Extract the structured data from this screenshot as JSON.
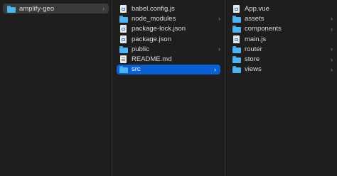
{
  "column1": {
    "items": [
      {
        "label": "amplify-geo",
        "icon": "folder-icon",
        "chevron": "›",
        "state": "selected-inactive"
      }
    ]
  },
  "column2": {
    "items": [
      {
        "label": "babel.config.js",
        "icon": "code-file-icon",
        "chevron": ""
      },
      {
        "label": "node_modules",
        "icon": "folder-icon",
        "chevron": "›"
      },
      {
        "label": "package-lock.json",
        "icon": "code-file-icon",
        "chevron": ""
      },
      {
        "label": "package.json",
        "icon": "code-file-icon",
        "chevron": ""
      },
      {
        "label": "public",
        "icon": "folder-icon",
        "chevron": "›"
      },
      {
        "label": "README.md",
        "icon": "text-file-icon",
        "chevron": ""
      },
      {
        "label": "src",
        "icon": "folder-icon",
        "chevron": "›",
        "state": "selected-active"
      }
    ]
  },
  "column3": {
    "items": [
      {
        "label": "App.vue",
        "icon": "code-file-icon",
        "chevron": ""
      },
      {
        "label": "assets",
        "icon": "folder-icon",
        "chevron": "›"
      },
      {
        "label": "components",
        "icon": "folder-icon",
        "chevron": "›"
      },
      {
        "label": "main.js",
        "icon": "code-file-icon",
        "chevron": ""
      },
      {
        "label": "router",
        "icon": "folder-icon",
        "chevron": "›"
      },
      {
        "label": "store",
        "icon": "folder-icon",
        "chevron": "›"
      },
      {
        "label": "views",
        "icon": "folder-icon",
        "chevron": "›"
      }
    ]
  },
  "colors": {
    "background": "#1e1e1e",
    "selection_active": "#0a5fd2",
    "selection_inactive": "#3a3a3c",
    "folder": "#4fb3f2"
  }
}
